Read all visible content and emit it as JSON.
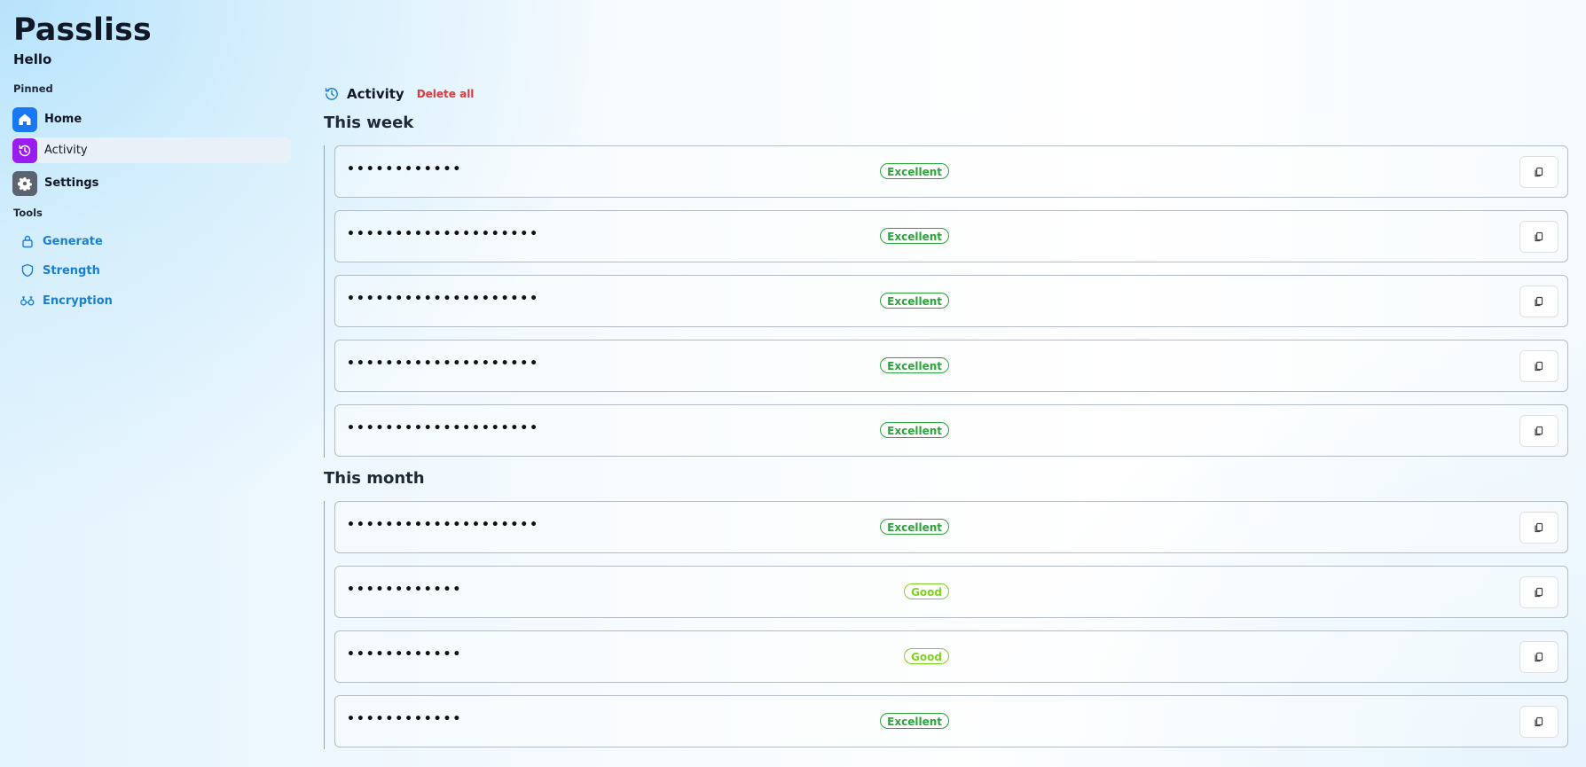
{
  "app": {
    "title": "Passliss",
    "greeting": "Hello"
  },
  "sidebar": {
    "pinned_label": "Pinned",
    "pinned": [
      {
        "label": "Home",
        "icon": "home-icon",
        "color": "#1877f2",
        "active": false
      },
      {
        "label": "Activity",
        "icon": "history-icon",
        "color": "#9a1cf0",
        "active": true
      },
      {
        "label": "Settings",
        "icon": "gear-icon",
        "color": "#5c6470",
        "active": false
      }
    ],
    "tools_label": "Tools",
    "tools": [
      {
        "label": "Generate",
        "icon": "lock-icon"
      },
      {
        "label": "Strength",
        "icon": "shield-icon"
      },
      {
        "label": "Encryption",
        "icon": "encryption-icon"
      }
    ]
  },
  "activity": {
    "title": "Activity",
    "delete_all": "Delete all",
    "groups": [
      {
        "title": "This week",
        "items": [
          {
            "password": "••••••••••••",
            "strength": "Excellent"
          },
          {
            "password": "••••••••••••••••••••",
            "strength": "Excellent"
          },
          {
            "password": "••••••••••••••••••••",
            "strength": "Excellent"
          },
          {
            "password": "••••••••••••••••••••",
            "strength": "Excellent"
          },
          {
            "password": "••••••••••••••••••••",
            "strength": "Excellent"
          }
        ]
      },
      {
        "title": "This month",
        "items": [
          {
            "password": "••••••••••••••••••••",
            "strength": "Excellent"
          },
          {
            "password": "••••••••••••",
            "strength": "Good"
          },
          {
            "password": "••••••••••••",
            "strength": "Good"
          },
          {
            "password": "••••••••••••",
            "strength": "Excellent"
          }
        ]
      }
    ]
  },
  "colors": {
    "excellent": "#2aa53a",
    "good": "#7ed321",
    "accent": "#1b7fd1",
    "danger": "#e0393e"
  }
}
